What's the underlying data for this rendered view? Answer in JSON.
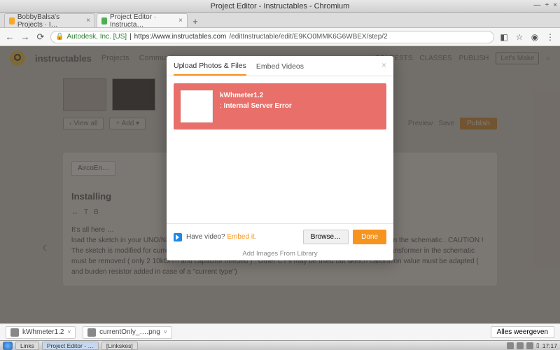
{
  "window": {
    "title": "Project Editor - Instructables - Chromium",
    "buttons": {
      "min": "—",
      "max": "+",
      "close": "×"
    }
  },
  "tabs": {
    "t1": "BobbyBalsa's Projects · I…",
    "t2": "Project Editor · Instructa…",
    "new": "+",
    "x": "×"
  },
  "nav": {
    "back": "←",
    "fwd": "→",
    "reload": "⟳",
    "security": "Autodesk, Inc. [US]",
    "sep": " | ",
    "host": "https://www.instructables.com",
    "path": "/editInstructable/edit/E9KO0MMK6G6WBEX/step/2",
    "ext": "◧",
    "star": "☆",
    "user": "◉",
    "menu": "⋮"
  },
  "site": {
    "brand": "instructables",
    "projects": "Projects",
    "community": "Community",
    "contests": "CONTESTS",
    "classes": "CLASSES",
    "publish": "PUBLISH",
    "signup": "Let's Make",
    "search": "⌕"
  },
  "editor": {
    "viewall": "‹ View all",
    "add": "+ Add ▾",
    "preview": "Preview",
    "save": "Save",
    "publish": "Publish",
    "chip": "AircoEn…",
    "step_title": "Installing",
    "tool_h": "↔",
    "tool_t": "T",
    "tool_b": "B",
    "body1": "It's all here …",
    "body2": "load the sketch in your UNO/Nano and connect the resistors/capacitor and current transformer as seen in the schematic . CAUTION ! The sketch is modified for current transformer Part Number SCT 013-050 . The resistor parallel to the transformer in the schematic must be removed ( only 2 10kOhm and capacitor needed ) . Other CT's may be used but sketch calibration value must be adapted ( and burden resistor added in case of a \"current type\")",
    "prev": "‹"
  },
  "modal": {
    "tab_upload": "Upload Photos & Files",
    "tab_embed": "Embed Videos",
    "close": "×",
    "file": "kWhmeter1.2",
    "err_prefix": ": ",
    "err_msg": "Internal Server Error",
    "video_q": "Have video? ",
    "video_link": "Embed it.",
    "browse": "Browse…",
    "done": "Done",
    "add_lib": "Add Images From Library"
  },
  "downloads": {
    "f1": "kWhmeter1.2",
    "f2": "currentOnly_….png",
    "caret": "˅",
    "showall": "Alles weergeven"
  },
  "taskbar": {
    "links": "Links",
    "app1": "Project Editor - …",
    "app2": "[Linkskes]",
    "time": "17:17",
    "tray": "▯"
  }
}
